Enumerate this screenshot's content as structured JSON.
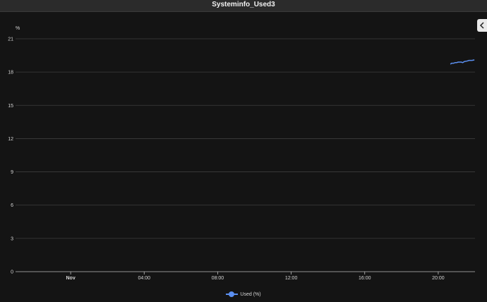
{
  "window": {
    "title": "Systeminfo_Used3"
  },
  "colors": {
    "background": "#141414",
    "grid": "#3e3e3e",
    "series": "#5b8ff0",
    "text": "#d6d6d6"
  },
  "chart_data": {
    "type": "line",
    "title": "",
    "xlabel": "",
    "ylabel": "%",
    "ylim": [
      0,
      21
    ],
    "xlim": [
      "Oct 31 21:00",
      "Nov 1 22:00"
    ],
    "y_ticks": [
      "0",
      "3",
      "6",
      "9",
      "12",
      "15",
      "18",
      "21"
    ],
    "x_ticks": [
      {
        "label": "Nov",
        "time": "Nov 1 00:00",
        "bold": true
      },
      {
        "label": "04:00",
        "time": "Nov 1 04:00",
        "bold": false
      },
      {
        "label": "08:00",
        "time": "Nov 1 08:00",
        "bold": false
      },
      {
        "label": "12:00",
        "time": "Nov 1 12:00",
        "bold": false
      },
      {
        "label": "16:00",
        "time": "Nov 1 16:00",
        "bold": false
      },
      {
        "label": "20:00",
        "time": "Nov 1 20:00",
        "bold": false
      }
    ],
    "grid": true,
    "legend": "bottom-center",
    "series": [
      {
        "name": "Used (%)",
        "points": [
          {
            "x": "Nov 1 20:40",
            "y": 18.7
          },
          {
            "x": "Nov 1 20:43",
            "y": 18.8
          },
          {
            "x": "Nov 1 20:50",
            "y": 18.8
          },
          {
            "x": "Nov 1 20:55",
            "y": 18.85
          },
          {
            "x": "Nov 1 21:00",
            "y": 18.85
          },
          {
            "x": "Nov 1 21:05",
            "y": 18.9
          },
          {
            "x": "Nov 1 21:15",
            "y": 18.9
          },
          {
            "x": "Nov 1 21:20",
            "y": 18.85
          },
          {
            "x": "Nov 1 21:25",
            "y": 18.95
          },
          {
            "x": "Nov 1 21:35",
            "y": 19.0
          },
          {
            "x": "Nov 1 21:40",
            "y": 19.05
          },
          {
            "x": "Nov 1 21:50",
            "y": 19.05
          },
          {
            "x": "Nov 1 21:58",
            "y": 19.1
          }
        ]
      }
    ]
  },
  "legend": {
    "label": "Used (%)"
  },
  "icons": {
    "collapse": "chevron-left-icon"
  }
}
